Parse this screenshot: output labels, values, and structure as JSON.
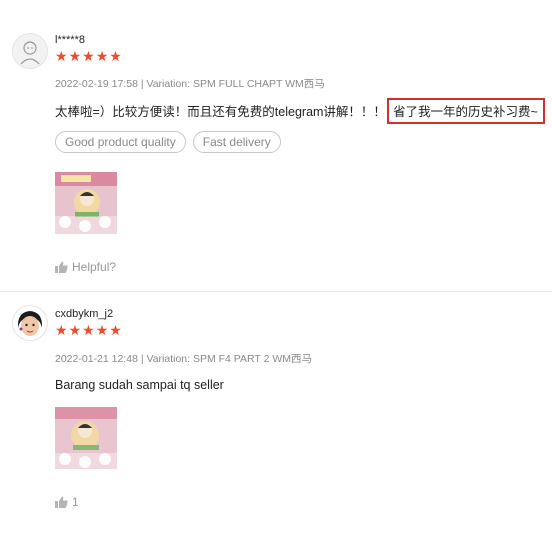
{
  "reviews": [
    {
      "username": "l*****8",
      "rating": 5,
      "meta": "2022-02-19 17:58 | Variation: SPM FULL CHAPT WM西马",
      "comment_main": "太棒啦=）比较方便读！而且还有免费的telegram讲解！！！",
      "comment_highlight": "省了我一年的历史补习费~",
      "tags": [
        "Good product quality",
        "Fast delivery"
      ],
      "helpful_label": "Helpful?"
    },
    {
      "username": "cxdbykm_j2",
      "rating": 5,
      "meta": "2022-01-21 12:48 | Variation: SPM F4 PART 2 WM西马",
      "comment_main": "Barang sudah sampai tq seller",
      "helpful_count": "1"
    }
  ],
  "colors": {
    "star": "#ee4d2d",
    "highlight_border": "#d32f2f",
    "meta_text": "#8a8a8a"
  },
  "icons": {
    "rating": "star-icon",
    "helpful": "thumbs-up-icon"
  }
}
